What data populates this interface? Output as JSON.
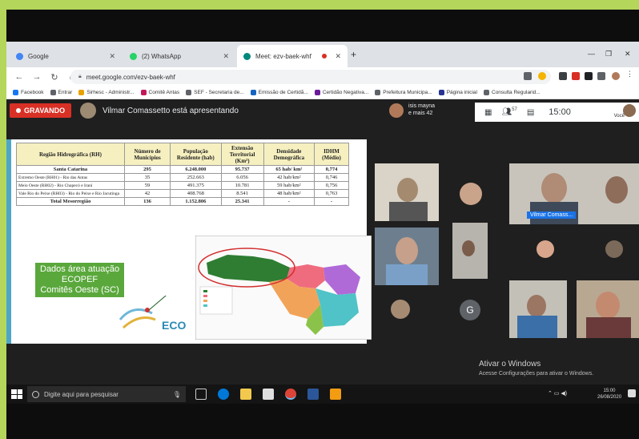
{
  "browser": {
    "tabs": [
      {
        "label": "Google",
        "color": "#4285f4"
      },
      {
        "label": "(2) WhatsApp",
        "color": "#25d366"
      },
      {
        "label": "Meet: ezv-baek-whf",
        "color": "#00897b"
      }
    ],
    "url": "meet.google.com/ezv-baek-whf",
    "bookmarks": [
      {
        "label": "Facebook",
        "color": "#1877f2"
      },
      {
        "label": "Entrar",
        "color": "#5f6368"
      },
      {
        "label": "Sirhesc - Administr...",
        "color": "#e8a200"
      },
      {
        "label": "Comitê Antas",
        "color": "#c2185b"
      },
      {
        "label": "SEF - Secretaria de...",
        "color": "#5f6368"
      },
      {
        "label": "Emissão de Certidã...",
        "color": "#1565c0"
      },
      {
        "label": "Certidão Negativa...",
        "color": "#6a1b9a"
      },
      {
        "label": "Prefeitura Municipa...",
        "color": "#5f6368"
      },
      {
        "label": "Página inicial",
        "color": "#283593"
      },
      {
        "label": "Consulta Regularid...",
        "color": "#5f6368"
      }
    ]
  },
  "meet": {
    "recording_label": "GRAVANDO",
    "presenting_text": "Vilmar Comassetto está apresentando",
    "others_line1": "isis mayna",
    "others_line2": "e mais 42",
    "participants_count": "57",
    "clock": "15:00",
    "you_label": "Você",
    "tile_name": "Vilmar Comass..."
  },
  "slide": {
    "table": {
      "headers": [
        "Região Hidrográfica (RH)",
        "Número de Municípios",
        "População Residente (hab)",
        "Extensão Territorial (Km²)",
        "Densidade Demográfica",
        "IDHM (Médio)"
      ],
      "rows": [
        [
          "Santa Catarina",
          "295",
          "6.248.000",
          "95.737",
          "65 hab/ km²",
          "0,774"
        ],
        [
          "Extremo Oeste (RH01) - Rio das Antas",
          "35",
          "252.663",
          "6.056",
          "42 hab/km²",
          "0,746"
        ],
        [
          "Meio Oeste (RH02) - Rio Chapecó e Irani",
          "59",
          "491.375",
          "10.781",
          "59 hab/km²",
          "0,756"
        ],
        [
          "Vale Rio do Peixe (RH03) - Rio do Peixe e Rio Jacutinga",
          "42",
          "408.768",
          "8.541",
          "48 hab/km²",
          "0,763"
        ],
        [
          "Total Mesorregião",
          "136",
          "1.152.806",
          "25.341",
          "-",
          "-"
        ]
      ]
    },
    "label_line1": "Dados área atuação",
    "label_line2": "ECOPEF",
    "label_line3": "Comitês Oeste (SC)",
    "logo_text": "ECO"
  },
  "watermark": {
    "title": "Ativar o Windows",
    "subtitle": "Acesse Configurações para ativar o Windows."
  },
  "taskbar": {
    "search_placeholder": "Digite aqui para pesquisar",
    "time": "15:00",
    "date": "26/08/2020"
  }
}
